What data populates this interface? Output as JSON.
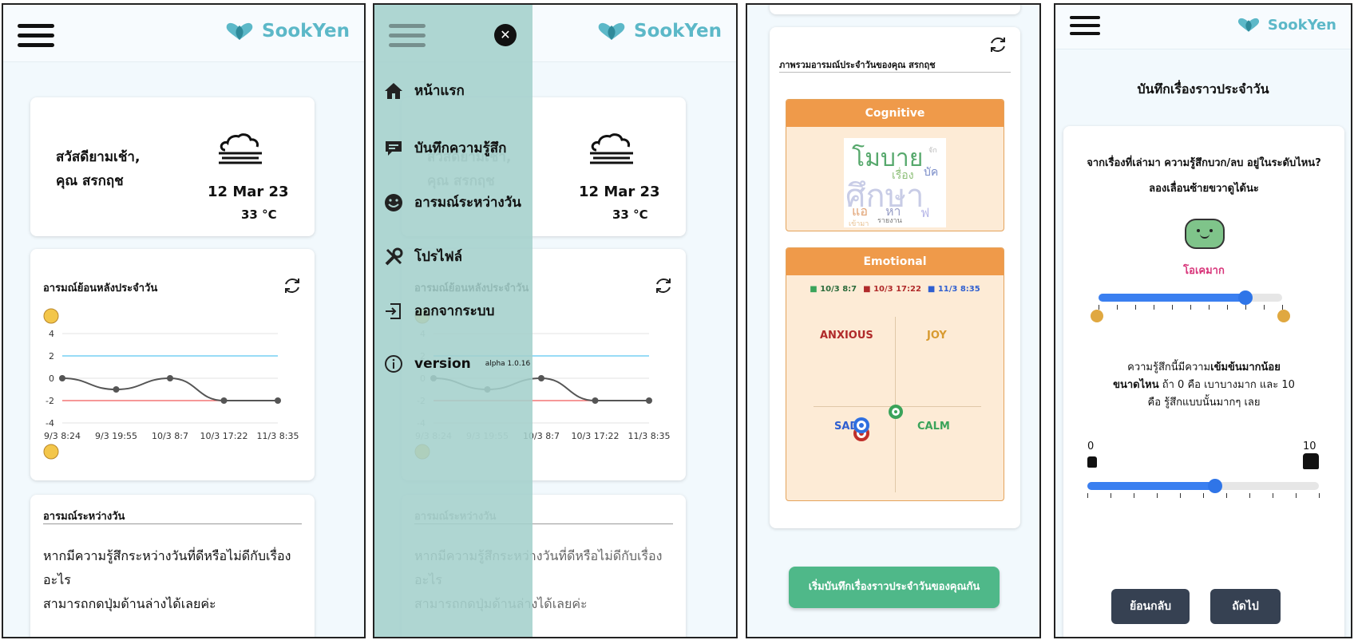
{
  "app": {
    "name": "SookYen"
  },
  "home": {
    "greeting_line1": "สวัสดียามเช้า,",
    "greeting_line2": "คุณ สรกฤช",
    "date": "12 Mar 23",
    "temperature": "33 °C",
    "mood_chart_title": "อารมณ์ย้อนหลังประจำวัน",
    "daytime_title": "อารมณ์ระหว่างวัน",
    "daytime_text_line1": "หากมีความรู้สึกระหว่างวันที่ดีหรือไม่ดีกับเรื่องอะไร",
    "daytime_text_line2": "สามารถกดปุ่มด้านล่างได้เลยค่ะ"
  },
  "chart_data": {
    "type": "line",
    "x": [
      "9/3 8:24",
      "9/3 19:55",
      "10/3 8:7",
      "10/3 17:22",
      "11/3 8:35"
    ],
    "values": [
      0,
      -1,
      0,
      -2,
      -2
    ],
    "ylim": [
      -4,
      4
    ],
    "yticks": [
      4,
      2,
      0,
      -2,
      -4
    ],
    "reference_lines": [
      {
        "value": 2,
        "color": "#5bc6f0"
      },
      {
        "value": -2,
        "color": "#f05a5a"
      }
    ],
    "line_color": "#555555",
    "grid": true
  },
  "menu": {
    "items": [
      {
        "label": "หน้าแรก",
        "icon": "home-icon"
      },
      {
        "label": "บันทึกความรู้สึก",
        "icon": "chat-icon"
      },
      {
        "label": "อารมณ์ระหว่างวัน",
        "icon": "smiley-icon"
      },
      {
        "label": "โปรไฟล์",
        "icon": "tools-icon"
      },
      {
        "label": "ออกจากระบบ",
        "icon": "logout-icon"
      },
      {
        "label": "version",
        "icon": "info-icon"
      }
    ],
    "version_number": "alpha 1.0.16"
  },
  "overview": {
    "title": "ภาพรวมอารมณ์ประจำวันของคุณ สรกฤช",
    "cognitive_label": "Cognitive",
    "emotional_label": "Emotional",
    "words": [
      "โมบาย",
      "ศึกษา",
      "เรื่อง",
      "บัค",
      "แอ",
      "หา",
      "ฟ",
      "รายงาน",
      "เข้ามา",
      "จัก"
    ],
    "legend": [
      {
        "label": "10/3 8:7",
        "color": "#3aa35a"
      },
      {
        "label": "10/3 17:22",
        "color": "#b02a2a"
      },
      {
        "label": "11/3 8:35",
        "color": "#2f5fd0"
      }
    ],
    "quadrants": {
      "anxious": "ANXIOUS",
      "joy": "JOY",
      "sad": "SAD",
      "calm": "CALM"
    },
    "start_button": "เริ่มบันทึกเรื่องราวประจำวันของคุณกัน"
  },
  "record": {
    "page_title": "บันทึกเรื่องราวประจำวัน",
    "question1": "จากเรื่องที่เล่ามา ความรู้สึกบวก/ลบ อยู่ในระดับไหน?",
    "hint1": "ลองเลื่อนซ้ายขวาดูได้นะ",
    "mood_label": "โอเคมาก",
    "valence_fraction": 0.8,
    "intensity_line1_a": "ความรู้สึกนี้มีความ",
    "intensity_line1_b": "เข้มข้นมากน้อย",
    "intensity_line2_a": "ขนาดไหน",
    "intensity_line2_b": " ถ้า 0 คือ เบาบางมาก และ 10",
    "intensity_line3": "คือ รู้สึกแบบนั้นมากๆ เลย",
    "intensity_min": "0",
    "intensity_max": "10",
    "intensity_fraction": 0.55,
    "back_button": "ย้อนกลับ",
    "next_button": "ถัดไป"
  }
}
